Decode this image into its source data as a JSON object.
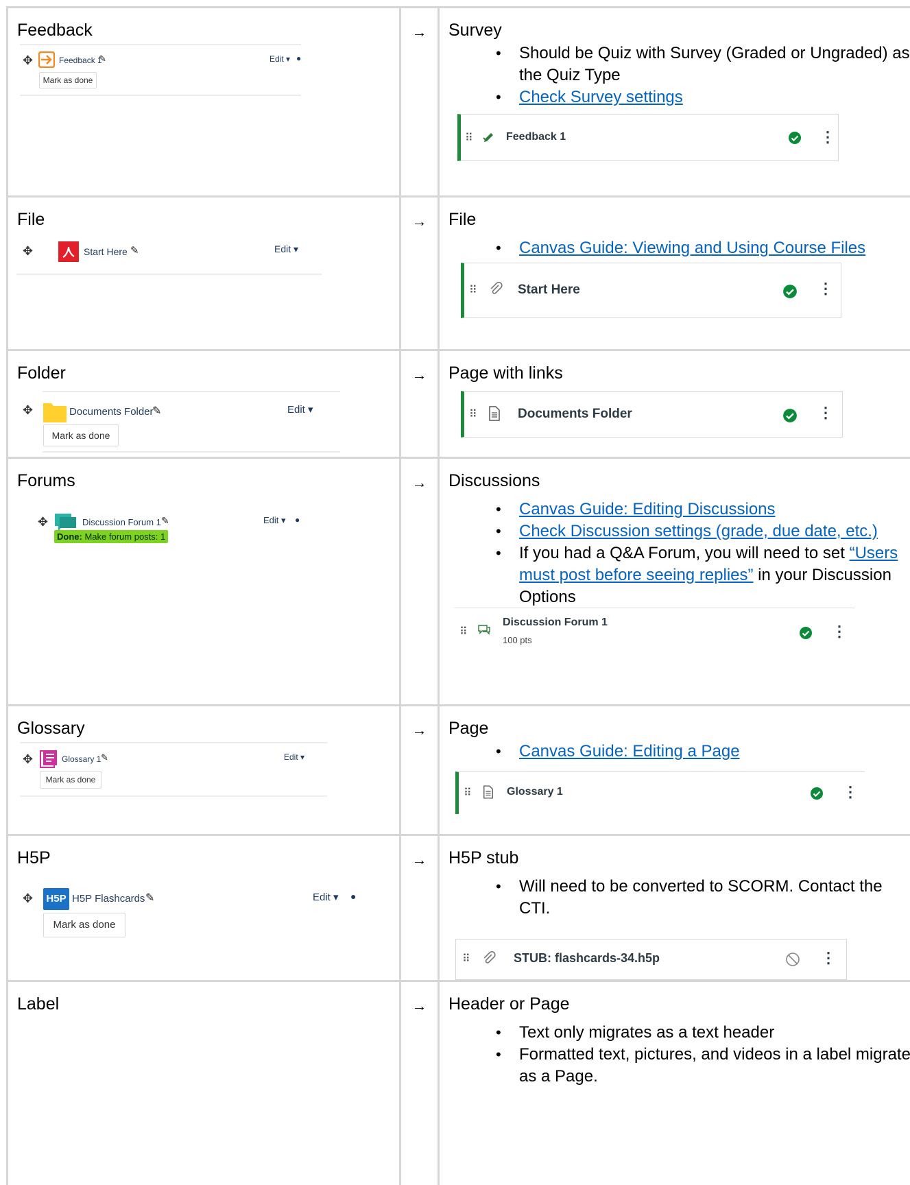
{
  "arrow": "→",
  "rows": [
    {
      "left": {
        "heading": "Feedback",
        "item_title": "Feedback 1",
        "edit": "Edit",
        "mark_done": "Mark as done"
      },
      "right": {
        "heading": "Survey",
        "notes": [
          "Should be Quiz with Survey (Graded or Ungraded) as the Quiz Type"
        ],
        "links": [
          "Check Survey settings"
        ],
        "canvas_title": "Feedback 1"
      }
    },
    {
      "left": {
        "heading": "File",
        "item_title": "Start Here",
        "edit": "Edit"
      },
      "right": {
        "heading": "File",
        "links": [
          "Canvas Guide: Viewing and Using Course Files"
        ],
        "canvas_title": "Start Here"
      }
    },
    {
      "left": {
        "heading": "Folder",
        "item_title": "Documents Folder",
        "edit": "Edit",
        "mark_done": "Mark as done"
      },
      "right": {
        "heading": "Page with links",
        "canvas_title": "Documents Folder"
      }
    },
    {
      "left": {
        "heading": "Forums",
        "item_title": "Discussion Forum 1",
        "edit": "Edit",
        "done_label": "Done:",
        "done_text": "Make forum posts: 1"
      },
      "right": {
        "heading": "Discussions",
        "links": [
          "Canvas Guide: Editing Discussions",
          "Check Discussion settings (grade, due date, etc.)"
        ],
        "note_pre": "If you had a Q&A Forum, you will need to set ",
        "note_link": "“Users must post before seeing replies”",
        "note_post": " in your Discussion Options",
        "canvas_title": "Discussion Forum 1",
        "canvas_sub": "100 pts"
      }
    },
    {
      "left": {
        "heading": "Glossary",
        "item_title": "Glossary 1",
        "edit": "Edit",
        "mark_done": "Mark as done"
      },
      "right": {
        "heading": "Page",
        "links": [
          "Canvas Guide: Editing a Page"
        ],
        "canvas_title": "Glossary 1"
      }
    },
    {
      "left": {
        "heading": "H5P",
        "item_title": "H5P Flashcards",
        "icon_text": "H5P",
        "edit": "Edit",
        "mark_done": "Mark as done"
      },
      "right": {
        "heading": "H5P stub",
        "notes": [
          "Will need to be converted to SCORM. Contact the CTI."
        ],
        "canvas_title": "STUB: flashcards-34.h5p"
      }
    },
    {
      "left": {
        "heading": "Label"
      },
      "right": {
        "heading": "Header or Page",
        "notes": [
          "Text only migrates as a text header",
          "Formatted text, pictures, and videos in a label migrate as a Page."
        ]
      }
    }
  ],
  "colors": {
    "link": "#0563c1",
    "canvas_green": "#1c8a3a",
    "border": "#d6d6d6"
  }
}
